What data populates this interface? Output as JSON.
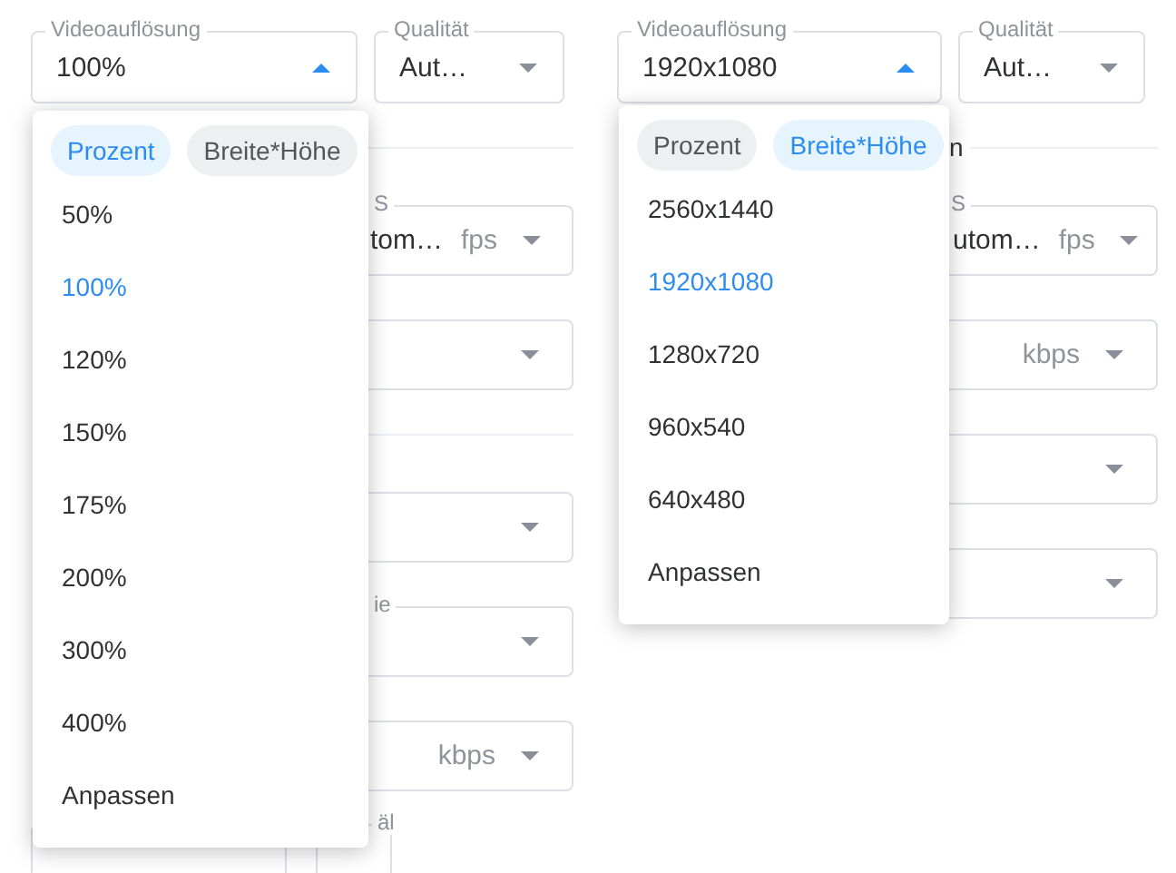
{
  "panels": [
    {
      "resolution": {
        "label": "Videoauflösung",
        "value": "100%",
        "expanded": true
      },
      "quality": {
        "label": "Qualität",
        "value": "Aut…",
        "expanded": false
      },
      "dropdown": {
        "tabs": [
          {
            "label": "Prozent",
            "selected": true
          },
          {
            "label": "Breite*Höhe",
            "selected": false
          }
        ],
        "options": [
          {
            "label": "50%",
            "selected": false
          },
          {
            "label": "100%",
            "selected": true
          },
          {
            "label": "120%",
            "selected": false
          },
          {
            "label": "150%",
            "selected": false
          },
          {
            "label": "175%",
            "selected": false
          },
          {
            "label": "200%",
            "selected": false
          },
          {
            "label": "300%",
            "selected": false
          },
          {
            "label": "400%",
            "selected": false
          },
          {
            "label": "Anpassen",
            "selected": false
          }
        ]
      },
      "background": [
        {
          "kind": "divider"
        },
        {
          "kind": "field",
          "label": "S",
          "value": "tom…",
          "unit": "fps"
        },
        {
          "kind": "field"
        },
        {
          "kind": "divider"
        },
        {
          "kind": "field"
        },
        {
          "kind": "field",
          "label": "ie"
        },
        {
          "kind": "field",
          "unit": "kbps"
        },
        {
          "kind": "pair",
          "label": "äl"
        }
      ]
    },
    {
      "resolution": {
        "label": "Videoauflösung",
        "value": "1920x1080",
        "expanded": true
      },
      "quality": {
        "label": "Qualität",
        "value": "Aut…",
        "expanded": false
      },
      "dropdown": {
        "tabs": [
          {
            "label": "Prozent",
            "selected": false
          },
          {
            "label": "Breite*Höhe",
            "selected": true
          }
        ],
        "options": [
          {
            "label": "2560x1440",
            "selected": false
          },
          {
            "label": "1920x1080",
            "selected": true
          },
          {
            "label": "1280x720",
            "selected": false
          },
          {
            "label": "960x540",
            "selected": false
          },
          {
            "label": "640x480",
            "selected": false
          },
          {
            "label": "Anpassen",
            "selected": false
          }
        ]
      },
      "background": [
        {
          "kind": "divider",
          "title": "n"
        },
        {
          "kind": "field",
          "label": "S",
          "value": "utom…",
          "unit": "fps"
        },
        {
          "kind": "field",
          "unit": "kbps"
        },
        {
          "kind": "field"
        },
        {
          "kind": "field"
        }
      ]
    }
  ]
}
